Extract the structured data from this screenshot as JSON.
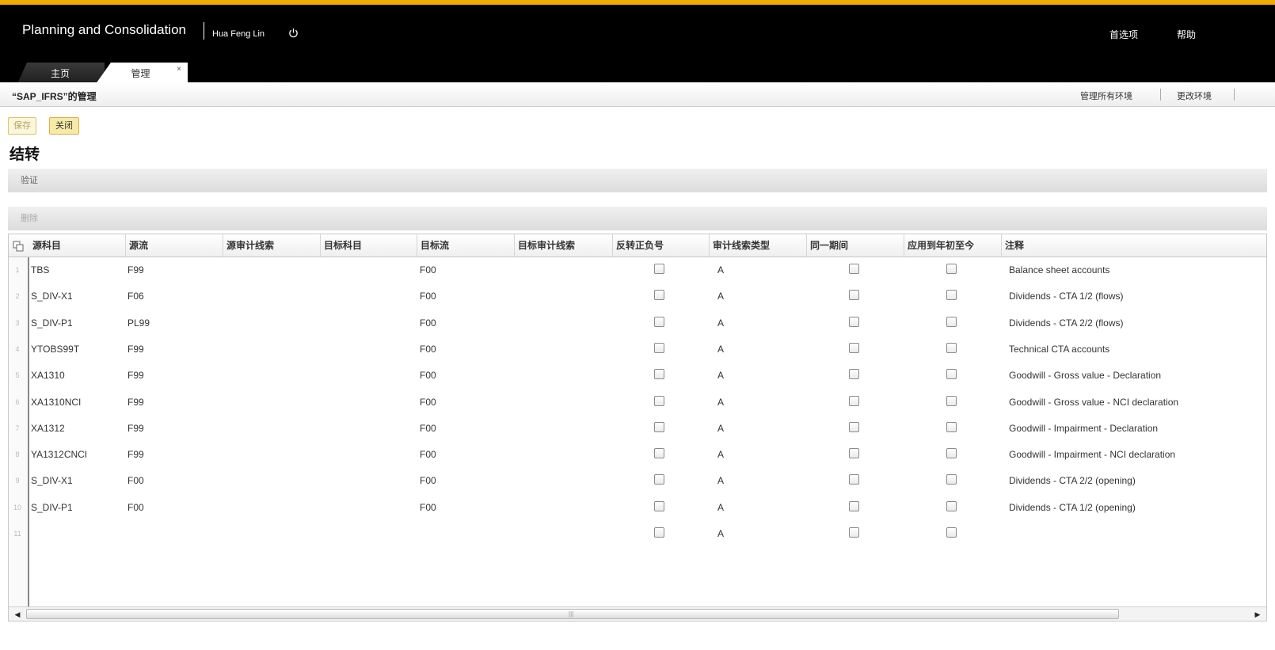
{
  "app": {
    "title": "Planning and Consolidation",
    "user": "Hua Feng Lin",
    "preferences_label": "首选项",
    "help_label": "帮助"
  },
  "tabs": [
    {
      "label": "主页"
    },
    {
      "label": "管理",
      "close": "×"
    }
  ],
  "subheader": {
    "title": "“SAP_IFRS”的管理",
    "manage_env": "管理所有环境",
    "change_env": "更改环境"
  },
  "toolbar": {
    "save_label": "保存",
    "close_label": "关闭"
  },
  "page_title": "结转",
  "sections": {
    "validate": "验证",
    "delete": "删除"
  },
  "grid": {
    "columns": [
      "源科目",
      "源流",
      "源审计线索",
      "目标科目",
      "目标流",
      "目标审计线索",
      "反转正负号",
      "审计线索类型",
      "同一期间",
      "应用到年初至今",
      "注释"
    ],
    "rows": [
      {
        "num": "1",
        "src_account": "TBS",
        "src_flow": "F99",
        "tgt_flow": "F00",
        "audit_type": "A",
        "comment": "Balance sheet accounts"
      },
      {
        "num": "2",
        "src_account": "S_DIV-X1",
        "src_flow": "F06",
        "tgt_flow": "F00",
        "audit_type": "A",
        "comment": "Dividends - CTA 1/2 (flows)"
      },
      {
        "num": "3",
        "src_account": "S_DIV-P1",
        "src_flow": "PL99",
        "tgt_flow": "F00",
        "audit_type": "A",
        "comment": "Dividends - CTA 2/2 (flows)"
      },
      {
        "num": "4",
        "src_account": "YTOBS99T",
        "src_flow": "F99",
        "tgt_flow": "F00",
        "audit_type": "A",
        "comment": "Technical CTA accounts"
      },
      {
        "num": "5",
        "src_account": "XA1310",
        "src_flow": "F99",
        "tgt_flow": "F00",
        "audit_type": "A",
        "comment": "Goodwill - Gross value - Declaration"
      },
      {
        "num": "6",
        "src_account": "XA1310NCI",
        "src_flow": "F99",
        "tgt_flow": "F00",
        "audit_type": "A",
        "comment": "Goodwill - Gross value - NCI declaration"
      },
      {
        "num": "7",
        "src_account": "XA1312",
        "src_flow": "F99",
        "tgt_flow": "F00",
        "audit_type": "A",
        "comment": "Goodwill - Impairment - Declaration"
      },
      {
        "num": "8",
        "src_account": "YA1312CNCI",
        "src_flow": "F99",
        "tgt_flow": "F00",
        "audit_type": "A",
        "comment": "Goodwill - Impairment - NCI declaration"
      },
      {
        "num": "9",
        "src_account": "S_DIV-X1",
        "src_flow": "F00",
        "tgt_flow": "F00",
        "audit_type": "A",
        "comment": "Dividends - CTA 2/2 (opening)"
      },
      {
        "num": "10",
        "src_account": "S_DIV-P1",
        "src_flow": "F00",
        "tgt_flow": "F00",
        "audit_type": "A",
        "comment": "Dividends - CTA 1/2 (opening)"
      },
      {
        "num": "11",
        "src_account": "",
        "src_flow": "",
        "tgt_flow": "",
        "audit_type": "A",
        "comment": ""
      }
    ]
  },
  "scrollbar": {
    "left_arrow": "◀",
    "right_arrow": "▶",
    "grip": "|||"
  },
  "colors": {
    "accent": "#f0ab00",
    "header_bg": "#000000",
    "button_bg": "#f7e9a6"
  }
}
